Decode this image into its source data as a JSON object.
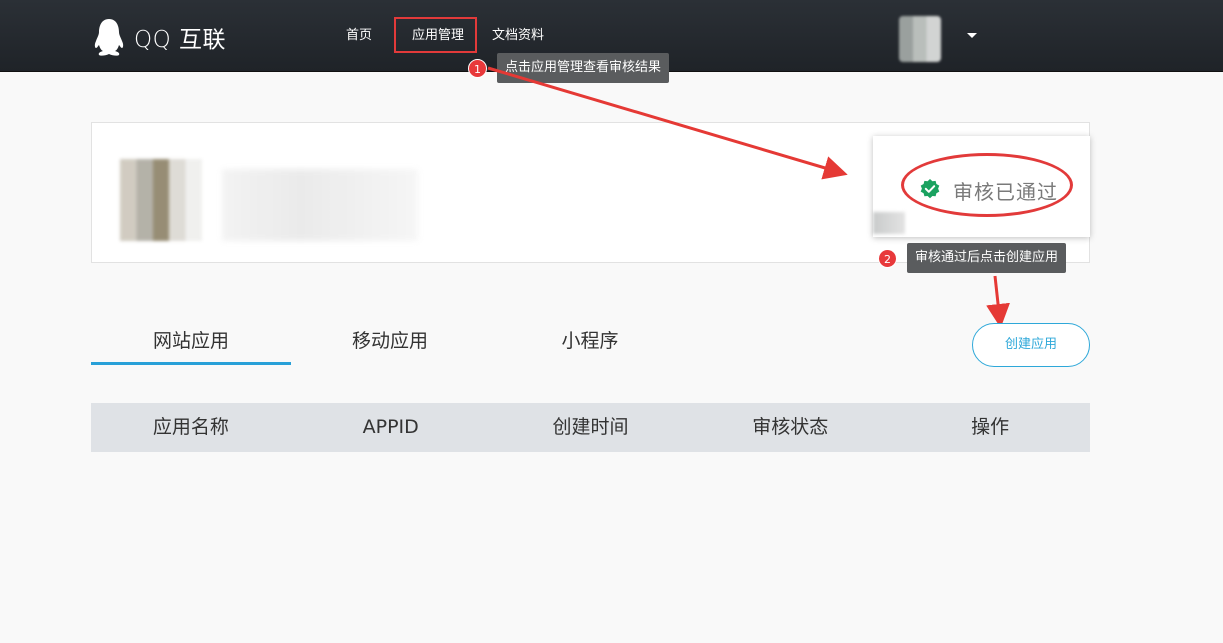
{
  "header": {
    "logo_text": "QQ 互联",
    "nav": {
      "home": "首页",
      "app_manage": "应用管理",
      "docs": "文档资料"
    }
  },
  "annotations": {
    "step1": {
      "number": "1",
      "text": "点击应用管理查看审核结果"
    },
    "step2": {
      "number": "2",
      "text": "审核通过后点击创建应用"
    }
  },
  "status": {
    "text": "审核已通过",
    "color": "#1aa260"
  },
  "tabs": [
    "网站应用",
    "移动应用",
    "小程序"
  ],
  "active_tab": "网站应用",
  "create_button": "创建应用",
  "table": {
    "columns": [
      "应用名称",
      "APPID",
      "创建时间",
      "审核状态",
      "操作"
    ]
  },
  "colors": {
    "header_bg": "#23272c",
    "accent": "#2ea8d9",
    "annotation_red": "#e23a3a"
  }
}
